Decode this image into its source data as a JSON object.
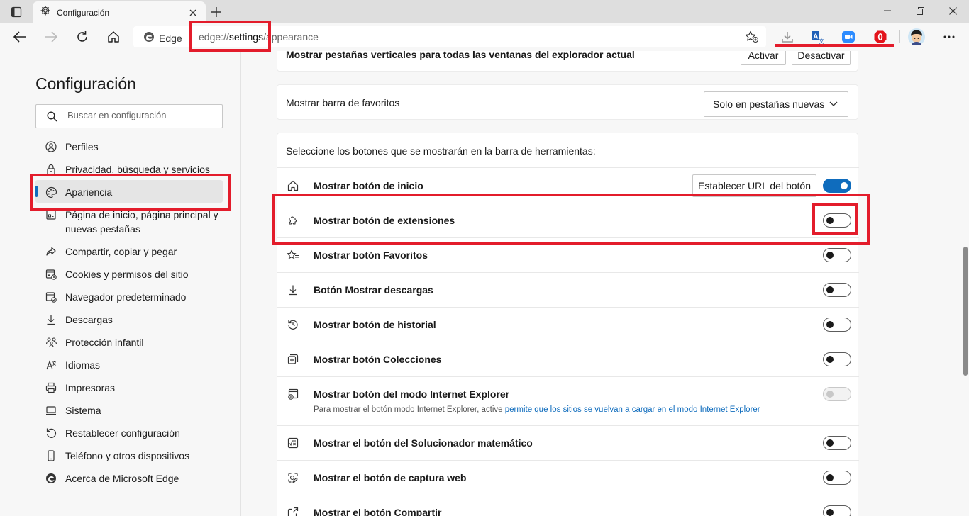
{
  "browser": {
    "tab_title": "Configuración",
    "address_brand": "Edge",
    "url_prefix": "edge://",
    "url_highlight": "settings",
    "url_suffix": "/appearance",
    "extensions": [
      "download-icon",
      "translator-icon",
      "zoom-icon",
      "opera-icon"
    ],
    "accent_red": "#e31c2b"
  },
  "sidebar": {
    "title": "Configuración",
    "search_placeholder": "Buscar en configuración",
    "items": [
      {
        "label": "Perfiles",
        "icon": "profile-icon"
      },
      {
        "label": "Privacidad, búsqueda y servicios",
        "icon": "lock-icon"
      },
      {
        "label": "Apariencia",
        "icon": "palette-icon",
        "active": true
      },
      {
        "label": "Página de inicio, página principal y nuevas pestañas",
        "icon": "start-page-icon"
      },
      {
        "label": "Compartir, copiar y pegar",
        "icon": "share-icon"
      },
      {
        "label": "Cookies y permisos del sitio",
        "icon": "cookies-icon"
      },
      {
        "label": "Navegador predeterminado",
        "icon": "default-browser-icon"
      },
      {
        "label": "Descargas",
        "icon": "download-icon"
      },
      {
        "label": "Protección infantil",
        "icon": "family-icon"
      },
      {
        "label": "Idiomas",
        "icon": "language-icon"
      },
      {
        "label": "Impresoras",
        "icon": "printer-icon"
      },
      {
        "label": "Sistema",
        "icon": "system-icon"
      },
      {
        "label": "Restablecer configuración",
        "icon": "reset-icon"
      },
      {
        "label": "Teléfono y otros dispositivos",
        "icon": "phone-icon"
      },
      {
        "label": "Acerca de Microsoft Edge",
        "icon": "edge-icon"
      }
    ]
  },
  "main": {
    "vertical_tabs": {
      "label": "Mostrar pestañas verticales para todas las ventanas del explorador actual",
      "activate": "Activar",
      "deactivate": "Desactivar"
    },
    "favorites_bar": {
      "label": "Mostrar barra de favoritos",
      "selected": "Solo en pestañas nuevas"
    },
    "toolbar_buttons": {
      "header": "Seleccione los botones que se mostrarán en la barra de herramientas:",
      "set_url_button": "Establecer URL del botón",
      "rows": [
        {
          "label": "Mostrar botón de inicio",
          "icon": "home-icon",
          "state": "on"
        },
        {
          "label": "Mostrar botón de extensiones",
          "icon": "puzzle-icon",
          "state": "off"
        },
        {
          "label": "Mostrar botón Favoritos",
          "icon": "favorites-icon",
          "state": "off"
        },
        {
          "label": "Botón Mostrar descargas",
          "icon": "download-icon",
          "state": "off"
        },
        {
          "label": "Mostrar botón de historial",
          "icon": "history-icon",
          "state": "off"
        },
        {
          "label": "Mostrar botón Colecciones",
          "icon": "collections-icon",
          "state": "off"
        },
        {
          "label": "Mostrar botón del modo Internet Explorer",
          "icon": "ie-mode-icon",
          "state": "disabled",
          "sub_text": "Para mostrar el botón modo Internet Explorer, active ",
          "sub_link": "permite que los sitios se vuelvan a cargar en el modo Internet Explorer"
        },
        {
          "label": "Mostrar el botón del Solucionador matemático",
          "icon": "math-solver-icon",
          "state": "off"
        },
        {
          "label": "Mostrar el botón de captura web",
          "icon": "web-capture-icon",
          "state": "off"
        },
        {
          "label": "Mostrar el botón Compartir",
          "icon": "share-icon",
          "state": "off"
        }
      ]
    }
  }
}
